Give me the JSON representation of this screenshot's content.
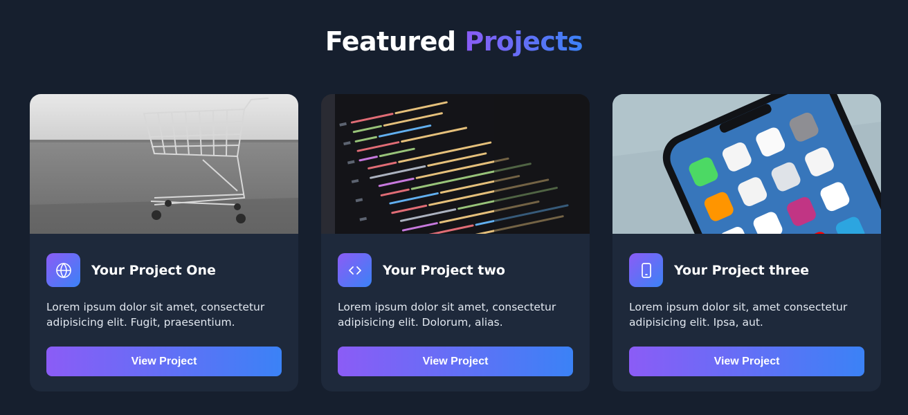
{
  "header": {
    "title_main": "Featured",
    "title_accent": "Projects"
  },
  "colors": {
    "background": "#161f2e",
    "card": "#1e293b",
    "accent_start": "#8b5cf6",
    "accent_end": "#3b82f6"
  },
  "projects": [
    {
      "title": "Your Project One",
      "description": "Lorem ipsum dolor sit amet, consectetur adipisicing elit. Fugit, praesentium.",
      "icon": "globe-icon",
      "image": "shopping-cart-photo",
      "button_label": "View Project"
    },
    {
      "title": "Your Project two",
      "description": "Lorem ipsum dolor sit amet, consectetur adipisicing elit. Dolorum, alias.",
      "icon": "code-icon",
      "image": "code-screen-photo",
      "button_label": "View Project"
    },
    {
      "title": "Your Project three",
      "description": "Lorem ipsum dolor sit, amet consectetur adipisicing elit. Ipsa, aut.",
      "icon": "smartphone-icon",
      "image": "smartphone-photo",
      "button_label": "View Project"
    }
  ]
}
